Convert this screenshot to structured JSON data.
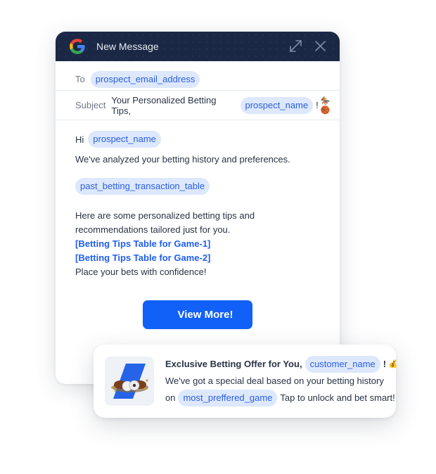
{
  "window": {
    "title": "New Message",
    "icons": {
      "logo": "google-g-logo",
      "expand": "expand-arrows-icon",
      "close": "close-icon"
    }
  },
  "compose": {
    "to_label": "To",
    "to_value": "prospect_email_address",
    "subject_label": "Subject",
    "subject_text": "Your Personalized Betting Tips,",
    "subject_chip": "prospect_name",
    "subject_suffix": "!",
    "subject_emoji": "🏇🏀"
  },
  "body": {
    "greeting": "Hi",
    "greeting_chip": "prospect_name",
    "line1": "We've analyzed your betting history and preferences.",
    "table_chip": "past_betting_transaction_table",
    "para2_line1": "Here are some personalized betting tips and",
    "para2_line2": "recommendations tailored just for you.",
    "link1": "[Betting Tips Table for Game-1]",
    "link2": "[Betting Tips Table for Game-2]",
    "closing": "Place your bets with confidence!",
    "cta_label": "View More!"
  },
  "notification": {
    "title": "Exclusive Betting Offer for You,",
    "title_chip": "customer_name",
    "title_suffix": "!",
    "title_emoji": "💰",
    "line1": "We've got a special deal based on your betting history",
    "line2_prefix": "on",
    "line2_chip": "most_preffered_game",
    "line2_suffix": "Tap to unlock and bet smart!",
    "thumbnail": "sports-balls-betting-image"
  },
  "colors": {
    "titlebar": "#1b2845",
    "chip_bg": "#dde8fd",
    "chip_text": "#2a5fe0",
    "link": "#1f5ef0",
    "cta": "#1160f7"
  }
}
